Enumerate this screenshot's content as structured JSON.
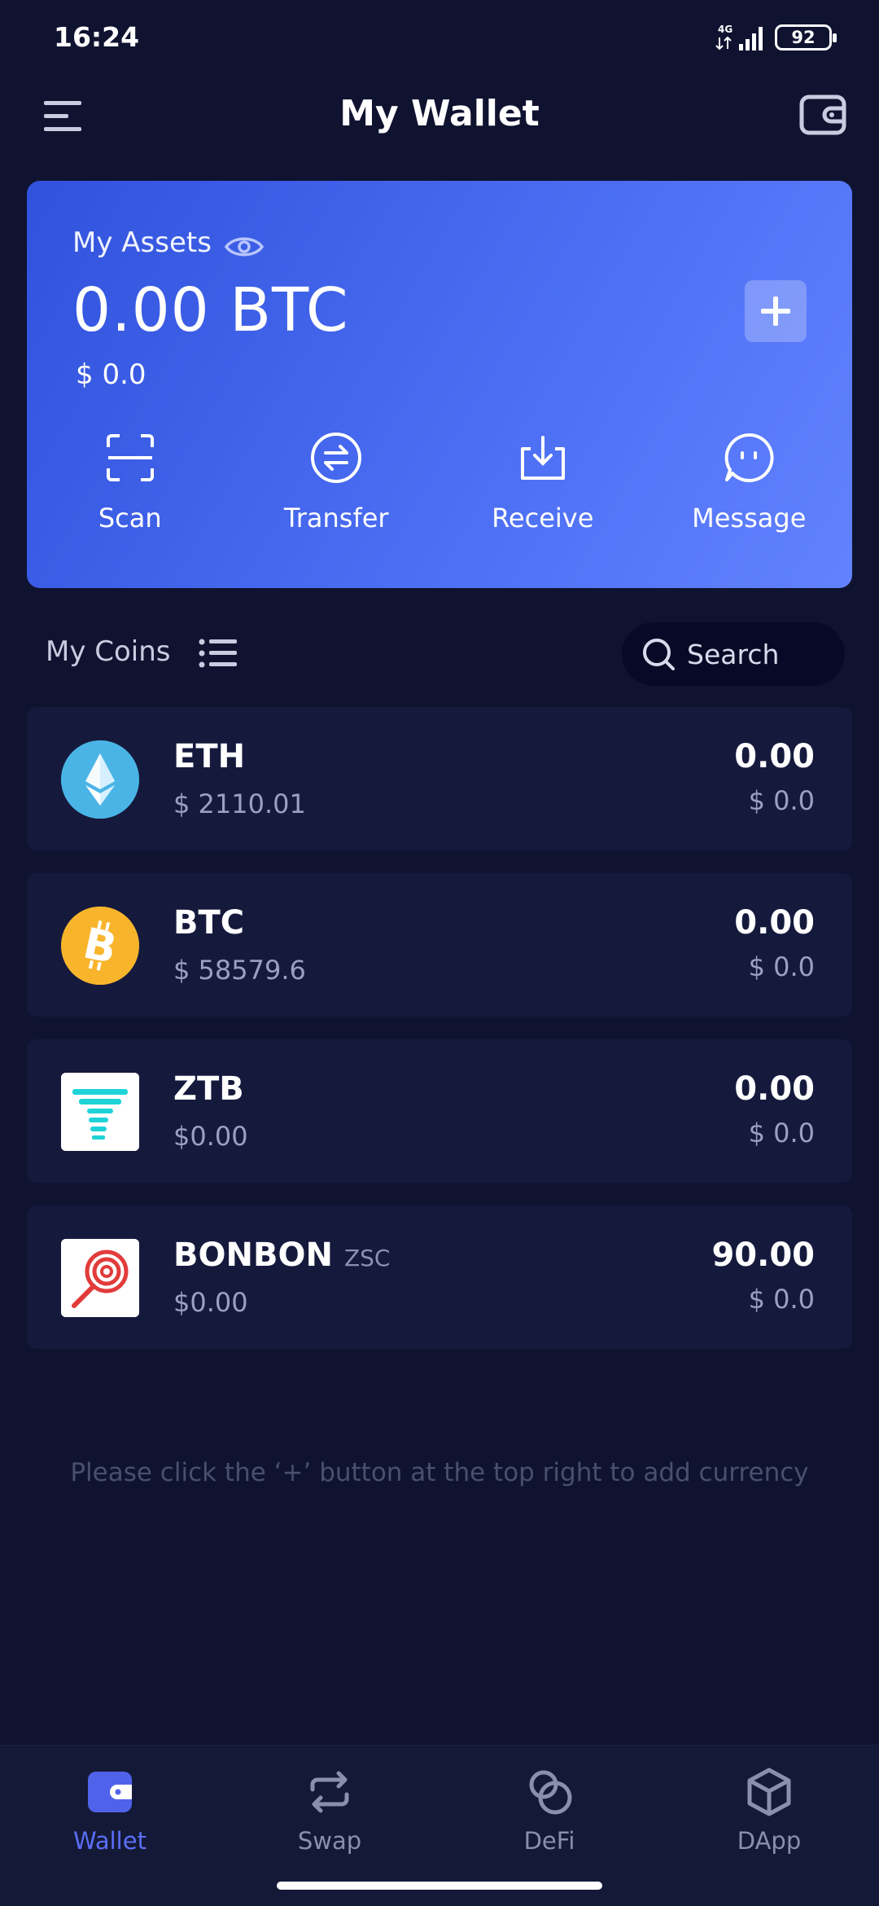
{
  "status_bar": {
    "time": "16:24",
    "network": "4G",
    "battery": "92"
  },
  "header": {
    "title": "My Wallet"
  },
  "assets": {
    "label": "My Assets",
    "value": "0.00 BTC",
    "usd_value": "$ 0.0",
    "actions": [
      {
        "label": "Scan",
        "icon": "scan-icon"
      },
      {
        "label": "Transfer",
        "icon": "transfer-icon"
      },
      {
        "label": "Receive",
        "icon": "receive-icon"
      },
      {
        "label": "Message",
        "icon": "message-icon"
      }
    ]
  },
  "coins": {
    "title": "My Coins",
    "search_label": "Search",
    "items": [
      {
        "symbol": "ETH",
        "chain": "",
        "price": "$ 2110.01",
        "amount": "0.00",
        "value": "$ 0.0",
        "icon": "eth-logo"
      },
      {
        "symbol": "BTC",
        "chain": "",
        "price": "$ 58579.6",
        "amount": "0.00",
        "value": "$ 0.0",
        "icon": "btc-logo"
      },
      {
        "symbol": "ZTB",
        "chain": "",
        "price": "$0.00",
        "amount": "0.00",
        "value": "$ 0.0",
        "icon": "ztb-logo"
      },
      {
        "symbol": "BONBON",
        "chain": "ZSC",
        "price": "$0.00",
        "amount": "90.00",
        "value": "$ 0.0",
        "icon": "bonbon-logo"
      }
    ]
  },
  "hint": "Please click the ‘+’ button at the top right to add currency",
  "bottom_nav": {
    "items": [
      {
        "label": "Wallet",
        "icon": "wallet-icon",
        "active": true
      },
      {
        "label": "Swap",
        "icon": "swap-icon",
        "active": false
      },
      {
        "label": "DeFi",
        "icon": "defi-icon",
        "active": false
      },
      {
        "label": "DApp",
        "icon": "dapp-icon",
        "active": false
      }
    ]
  },
  "colors": {
    "background": "#0f1330",
    "card_gradient_start": "#3152dc",
    "card_gradient_end": "#6282ff",
    "row_background": "#151a3d",
    "active_nav": "#5b6ef5"
  }
}
